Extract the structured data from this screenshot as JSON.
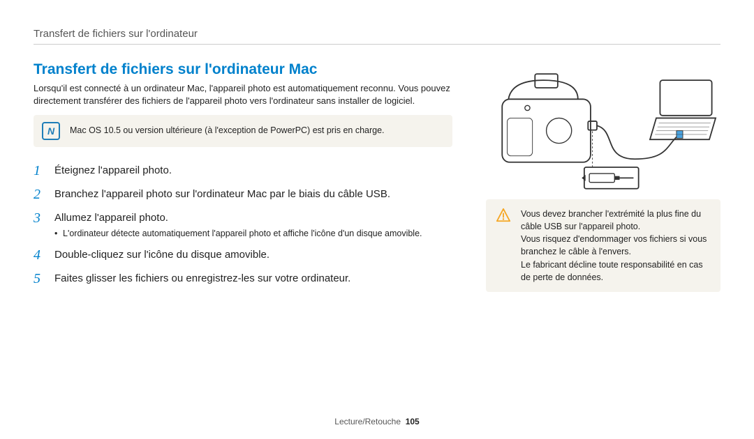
{
  "header": {
    "breadcrumb": "Transfert de fichiers sur l'ordinateur"
  },
  "main": {
    "title": "Transfert de fichiers sur l'ordinateur Mac",
    "intro": "Lorsqu'il est connecté à un ordinateur Mac, l'appareil photo est automatiquement reconnu. Vous pouvez directement transférer des fichiers de l'appareil photo vers l'ordinateur sans installer de logiciel.",
    "note": {
      "label": "N",
      "text": "Mac OS 10.5 ou version ultérieure (à l'exception de PowerPC) est pris en charge."
    },
    "steps": [
      {
        "num": "1",
        "text": "Éteignez l'appareil photo."
      },
      {
        "num": "2",
        "text": "Branchez l'appareil photo sur l'ordinateur Mac par le biais du câble USB."
      },
      {
        "num": "3",
        "text": "Allumez l'appareil photo.",
        "sub": "L'ordinateur détecte automatiquement l'appareil photo et affiche l'icône d'un disque amovible."
      },
      {
        "num": "4",
        "text": "Double-cliquez sur l'icône du disque amovible."
      },
      {
        "num": "5",
        "text": "Faites glisser les fichiers ou enregistrez-les sur votre ordinateur."
      }
    ]
  },
  "warning": {
    "lines": [
      "Vous devez brancher l'extrémité la plus fine du câble USB sur l'appareil photo.",
      "Vous risquez d'endommager vos fichiers si vous branchez le câble à l'envers.",
      "Le fabricant décline toute responsabilité en cas de perte de données."
    ]
  },
  "footer": {
    "section": "Lecture/Retouche",
    "page": "105"
  }
}
